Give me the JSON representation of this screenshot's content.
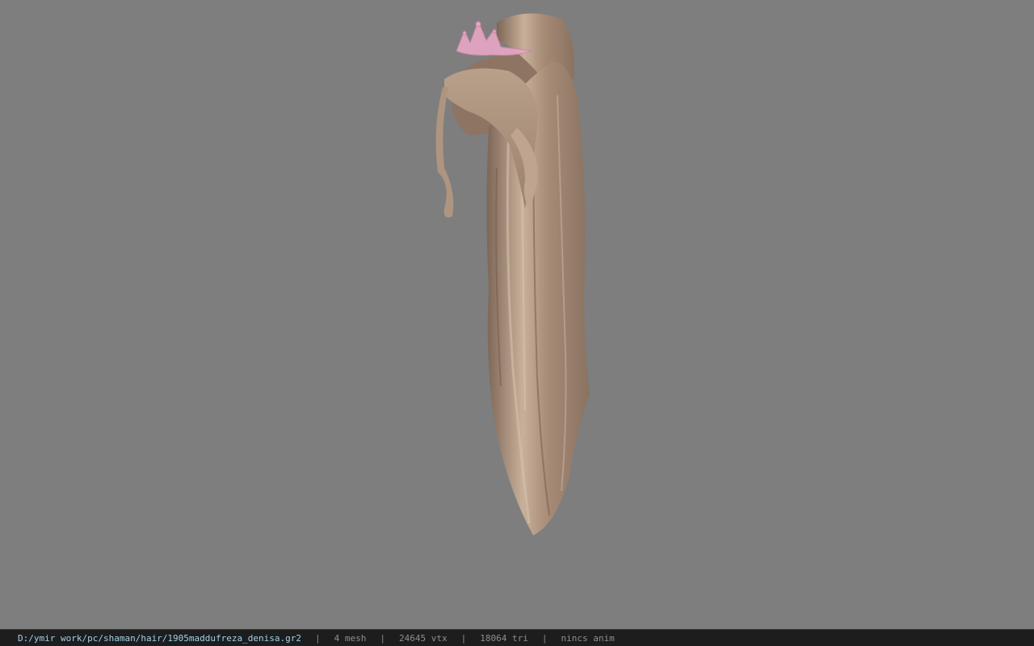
{
  "viewport": {
    "background_color": "#7e7e7e",
    "model": {
      "hair_color": "#b9a18c",
      "tiara_color": "#e8a6c4"
    }
  },
  "statusbar": {
    "file_path": "D:/ymir work/pc/shaman/hair/1905maddufreza_denisa.gr2",
    "mesh_count": "4 mesh",
    "vertex_count": "24645 vtx",
    "triangle_count": "18064 tri",
    "anim_status": "nincs anim",
    "separator": "|"
  }
}
